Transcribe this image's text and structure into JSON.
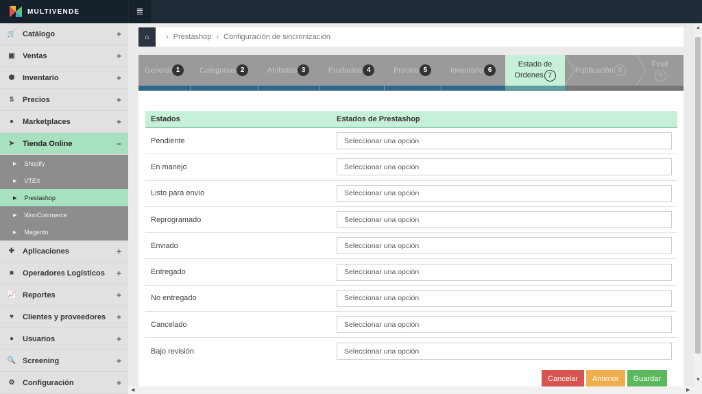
{
  "app": {
    "brand": "MULTIVENDE"
  },
  "sidebar": {
    "items": [
      {
        "label": "Catálogo",
        "icon": "cart-icon",
        "glyph": "🛒"
      },
      {
        "label": "Ventas",
        "icon": "money-icon",
        "glyph": "▣"
      },
      {
        "label": "Inventario",
        "icon": "cubes-icon",
        "glyph": "⬢"
      },
      {
        "label": "Precios",
        "icon": "dollar-icon",
        "glyph": "$"
      },
      {
        "label": "Marketplaces",
        "icon": "globe-icon",
        "glyph": "●"
      },
      {
        "label": "Tienda Online",
        "icon": "cursor-icon",
        "glyph": "➤",
        "expanded_mark": "−"
      }
    ],
    "sub_items": [
      "Shopify",
      "VTEX",
      "Prestashop",
      "WooCommerce",
      "Magento"
    ],
    "items_after": [
      {
        "label": "Aplicaciones",
        "icon": "puzzle-icon",
        "glyph": "✚"
      },
      {
        "label": "Operadores Logísticos",
        "icon": "truck-icon",
        "glyph": "■"
      },
      {
        "label": "Reportes",
        "icon": "chart-icon",
        "glyph": "📈"
      },
      {
        "label": "Clientes y proveedores",
        "icon": "heart-icon",
        "glyph": "♥"
      },
      {
        "label": "Usuarios",
        "icon": "user-icon",
        "glyph": "●"
      },
      {
        "label": "Screening",
        "icon": "search-icon",
        "glyph": "🔍"
      },
      {
        "label": "Configuración",
        "icon": "gear-icon",
        "glyph": "⚙"
      }
    ],
    "plus": "+"
  },
  "breadcrumb": {
    "items": [
      "Prestashop",
      "Configuración de sincronización"
    ],
    "sep": "›"
  },
  "steps": [
    {
      "label": "General",
      "num": "1"
    },
    {
      "label": "Categorias",
      "num": "2"
    },
    {
      "label": "Atributos",
      "num": "3"
    },
    {
      "label": "Productos",
      "num": "4"
    },
    {
      "label": "Precios",
      "num": "5"
    },
    {
      "label": "Inventario",
      "num": "6"
    },
    {
      "label": "Estado de",
      "label2": "Ordenes",
      "num": "7"
    },
    {
      "label": "Publicación",
      "num": "8"
    },
    {
      "label": "Final",
      "num": "9"
    }
  ],
  "table": {
    "headers": [
      "Estados",
      "Estados de Prestashop"
    ],
    "select_placeholder": "Seleccionar una opción",
    "rows": [
      "Pendiente",
      "En manejo",
      "Listo para envío",
      "Reprogramado",
      "Enviado",
      "Entregado",
      "No entregado",
      "Cancelado",
      "Bajo revisión"
    ]
  },
  "actions": {
    "cancel": "Cancelar",
    "previous": "Anterior",
    "save": "Guardar"
  },
  "colors": {
    "accent": "#a7e1c0",
    "topbar": "#202b38",
    "step_bar": "#2d6890"
  }
}
